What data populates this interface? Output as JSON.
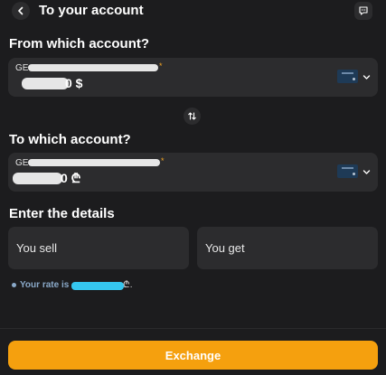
{
  "header": {
    "title": "To your account",
    "back_icon": "chevron-left-icon",
    "chat_icon": "chat-bubble-icon"
  },
  "from_section": {
    "title": "From which account?",
    "account_prefix": "GE",
    "balance_tail": "0 $",
    "star_mark": "*"
  },
  "to_section": {
    "title": "To which account?",
    "account_prefix": "GE",
    "balance_tail": "0 ₾",
    "star_mark": "*"
  },
  "details": {
    "title": "Enter the details",
    "sell_placeholder": "You sell",
    "get_placeholder": "You get"
  },
  "rate": {
    "label": "Your rate is",
    "tail": "₾."
  },
  "footer": {
    "exchange_label": "Exchange"
  },
  "colors": {
    "background": "#1c1c1e",
    "card": "#2c2c2e",
    "accent": "#f5a00e",
    "star": "#f5a623",
    "rate_text": "#8aa9c9"
  }
}
